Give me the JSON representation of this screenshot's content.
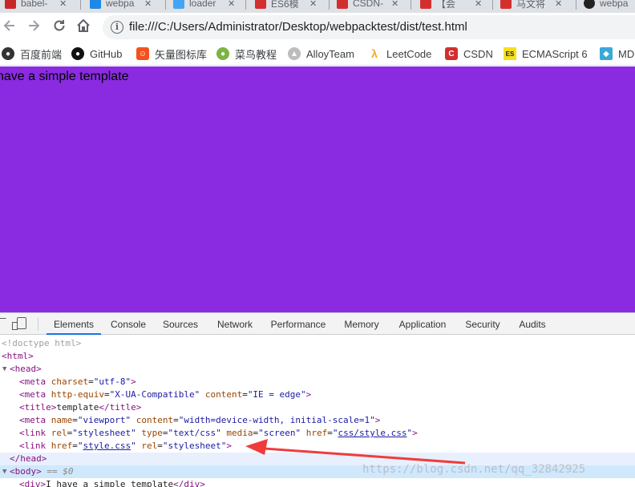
{
  "tabs": [
    {
      "label": "babel-",
      "color": "#c62828"
    },
    {
      "label": "webpa",
      "color": "#1e88e5"
    },
    {
      "label": "loader",
      "color": "#42a5f5"
    },
    {
      "label": "ES6模",
      "color": "#d32f2f"
    },
    {
      "label": "CSDN-",
      "color": "#d32f2f"
    },
    {
      "label": "【会",
      "color": "#d32f2f"
    },
    {
      "label": "马文将",
      "color": "#d32f2f"
    },
    {
      "label": "webpa",
      "color": "#222222"
    }
  ],
  "toolbar": {
    "back_icon": "arrow-left-icon",
    "forward_icon": "arrow-right-icon",
    "reload_icon": "reload-icon",
    "home_icon": "home-icon",
    "info_icon": "info-icon",
    "url": "file:///C:/Users/Administrator/Desktop/webpacktest/dist/test.html"
  },
  "bookmarks": [
    {
      "label": "百度前端",
      "icon": "baidu-icon",
      "color": "#333333",
      "glyph": "●"
    },
    {
      "label": "GitHub",
      "icon": "github-icon",
      "color": "#111111",
      "glyph": "●"
    },
    {
      "label": "矢量图标库",
      "icon": "iconfont-icon",
      "color": "#f4511e",
      "glyph": "☺"
    },
    {
      "label": "菜鸟教程",
      "icon": "runoob-icon",
      "color": "#7cb342",
      "glyph": "●"
    },
    {
      "label": "AlloyTeam",
      "icon": "alloyteam-icon",
      "color": "#bdbdbd",
      "glyph": "▲"
    },
    {
      "label": "LeetCode",
      "icon": "leetcode-icon",
      "color": "#f5a623",
      "glyph": "λ"
    },
    {
      "label": "CSDN",
      "icon": "csdn-icon",
      "color": "#d32f2f",
      "glyph": "C"
    },
    {
      "label": "ECMAScript 6",
      "icon": "es6-icon",
      "color": "#f7df1e",
      "glyph": "ES"
    },
    {
      "label": "MD",
      "icon": "mdn-icon",
      "color": "#39a9d8",
      "glyph": "◆"
    }
  ],
  "page": {
    "text": "have a simple template",
    "background": "#8a2be2"
  },
  "devtools": {
    "tabs": [
      "Elements",
      "Console",
      "Sources",
      "Network",
      "Performance",
      "Memory",
      "Application",
      "Security",
      "Audits"
    ],
    "active_tab": "Elements",
    "dom": {
      "doctype": "<!doctype html>",
      "html_open": "<html>",
      "head_open": "<head>",
      "meta1": {
        "tag": "meta",
        "attr": "charset",
        "val": "\"utf-8\""
      },
      "meta2": {
        "tag": "meta",
        "attr1": "http-equiv",
        "val1": "\"X-UA-Compatible\"",
        "attr2": "content",
        "val2": "\"IE = edge\""
      },
      "title": {
        "open": "<title>",
        "text": "template",
        "close": "</title>"
      },
      "meta3": {
        "tag": "meta",
        "attr1": "name",
        "val1": "\"viewport\"",
        "attr2": "content",
        "val2": "\"width=device-width, initial-scale=1\""
      },
      "link1": {
        "tag": "link",
        "attr1": "rel",
        "val1": "\"stylesheet\"",
        "attr2": "type",
        "val2": "\"text/css\"",
        "attr3": "media",
        "val3": "\"screen\"",
        "attr4": "href",
        "val4": "css/style.css"
      },
      "link2": {
        "tag": "link",
        "attr1": "href",
        "val1": "style.css",
        "attr2": "rel",
        "val2": "\"stylesheet\""
      },
      "head_close": "</head>",
      "body_open": "<body>",
      "body_marker": "== $0",
      "div": {
        "open": "<div>",
        "text": "I have a simple template",
        "close": "</div>"
      }
    }
  },
  "watermark": "https://blog.csdn.net/qq_32842925"
}
